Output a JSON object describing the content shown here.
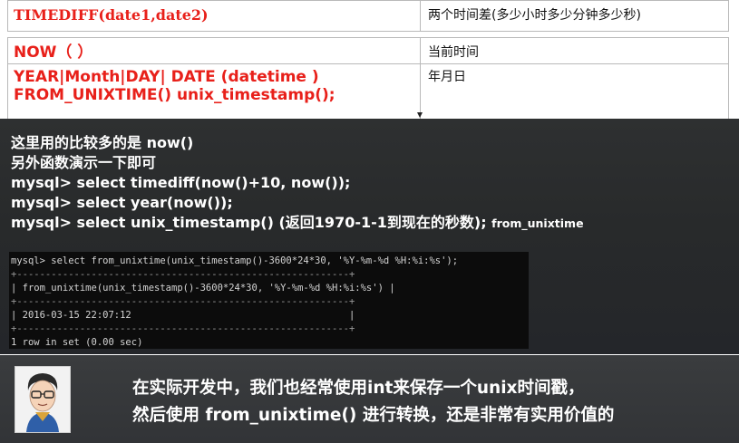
{
  "function_table": {
    "rows": [
      {
        "function": "TIMEDIFF(date1,date2)",
        "description": "两个时间差(多少小时多少分钟多少秒)"
      },
      {
        "function": "NOW（ ）",
        "description": "当前时间"
      },
      {
        "function_line1": "YEAR|Month|DAY| DATE (datetime )",
        "function_line2": "FROM_UNIXTIME()  unix_timestamp();",
        "description": "年月日"
      }
    ]
  },
  "notes": {
    "line1": "这里用的比较多的是 now()",
    "line2": "另外函数演示一下即可",
    "line3": "mysql> select timediff(now()+10, now());",
    "line4": "mysql> select year(now());",
    "line5_main": "mysql> select unix_timestamp() (返回1970-1-1到现在的秒数);",
    "line5_small": "from_unixtime"
  },
  "terminal": {
    "lines": [
      "mysql> select from_unixtime(unix_timestamp()-3600*24*30, '%Y-%m-%d %H:%i:%s');",
      "+----------------------------------------------------------+",
      "| from_unixtime(unix_timestamp()-3600*24*30, '%Y-%m-%d %H:%i:%s') |",
      "+----------------------------------------------------------+",
      "| 2016-03-15 22:07:12                                      |",
      "+----------------------------------------------------------+",
      "1 row in set (0.00 sec)"
    ]
  },
  "banner": {
    "line1": "在实际开发中，我们也经常使用int来保存一个unix时间戳，",
    "line2": "然后使用 from_unixtime() 进行转换，还是非常有实用价值的"
  },
  "colors": {
    "function_text": "#e8201a",
    "dark_background": "#2b2d2e",
    "terminal_background": "#0c0c0c"
  }
}
